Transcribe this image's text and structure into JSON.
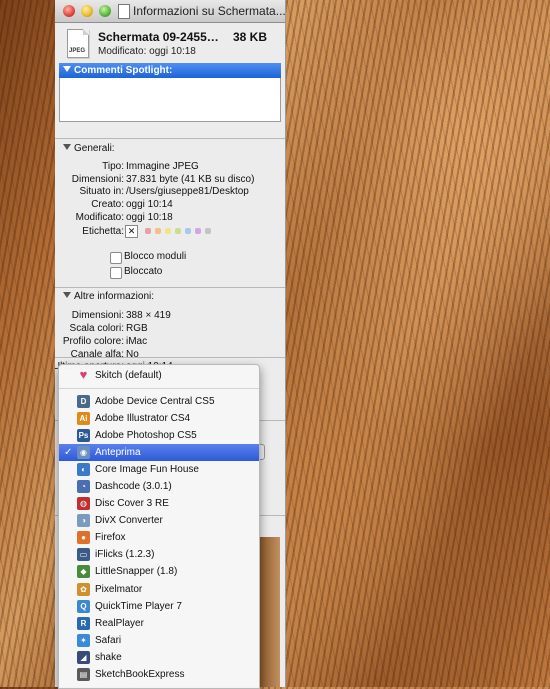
{
  "window": {
    "title": "Informazioni su Schermata..."
  },
  "header": {
    "icon_label": "JPEG",
    "file_name": "Schermata 09-2455…",
    "file_size": "38 KB",
    "modified": "Modificato:  oggi 10:18"
  },
  "spotlight": {
    "heading": "Commenti Spotlight:"
  },
  "general": {
    "heading": "Generali:",
    "rows": [
      {
        "key": "Tipo:",
        "value": "Immagine JPEG"
      },
      {
        "key": "Dimensioni:",
        "value": "37.831 byte (41 KB su disco)"
      },
      {
        "key": "Situato in:",
        "value": "/Users/giuseppe81/Desktop"
      },
      {
        "key": "Creato:",
        "value": "oggi 10:14"
      },
      {
        "key": "Modificato:",
        "value": "oggi 10:18"
      }
    ],
    "label_key": "Etichetta:",
    "label_colors": [
      "#e8a0a0",
      "#f3c08a",
      "#f2e28a",
      "#c9e08a",
      "#a7c9ef",
      "#d3a6df",
      "#c4c4c4"
    ],
    "checkbox_blocco_moduli": "Blocco moduli",
    "checkbox_bloccato": "Bloccato"
  },
  "more_info": {
    "heading": "Altre informazioni:",
    "rows": [
      {
        "key": "Dimensioni:",
        "value": "388 × 419"
      },
      {
        "key": "Scala colori:",
        "value": "RGB"
      },
      {
        "key": "Profilo colore:",
        "value": "iMac"
      },
      {
        "key": "Canale alfa:",
        "value": "No"
      },
      {
        "key": "Ultima apertura:",
        "value": "oggi 10:14"
      }
    ]
  },
  "open_with_menu": {
    "default_item": {
      "label": "Skitch (default)",
      "icon": "skitch-heart-icon",
      "color": "#d8407a"
    },
    "items": [
      {
        "label": "Adobe Device Central CS5",
        "icon": "adobe-device-central-icon",
        "color": "#4a6a8a",
        "glyph": "D"
      },
      {
        "label": "Adobe Illustrator CS4",
        "icon": "adobe-illustrator-icon",
        "color": "#e08a1a",
        "glyph": "Ai"
      },
      {
        "label": "Adobe Photoshop CS5",
        "icon": "adobe-photoshop-icon",
        "color": "#2a5a9a",
        "glyph": "Ps"
      },
      {
        "label": "Anteprima",
        "icon": "preview-icon",
        "color": "#6a8fc0",
        "glyph": "◉",
        "selected": true,
        "check": "✓"
      },
      {
        "label": "Core Image Fun House",
        "icon": "core-image-fun-house-icon",
        "color": "#3a7ac8",
        "glyph": "◐"
      },
      {
        "label": "Dashcode (3.0.1)",
        "icon": "dashcode-icon",
        "color": "#4a6fb0",
        "glyph": "◔"
      },
      {
        "label": "Disc Cover 3 RE",
        "icon": "disc-cover-icon",
        "color": "#c03030",
        "glyph": "◍"
      },
      {
        "label": "DivX Converter",
        "icon": "divx-converter-icon",
        "color": "#7a9ac0",
        "glyph": "◑"
      },
      {
        "label": "Firefox",
        "icon": "firefox-icon",
        "color": "#e0702a",
        "glyph": "●"
      },
      {
        "label": "iFlicks (1.2.3)",
        "icon": "iflicks-icon",
        "color": "#3a5a8a",
        "glyph": "▭"
      },
      {
        "label": "LittleSnapper (1.8)",
        "icon": "littlesnapper-icon",
        "color": "#4a8a3a",
        "glyph": "◆"
      },
      {
        "label": "Pixelmator",
        "icon": "pixelmator-icon",
        "color": "#d09030",
        "glyph": "✿"
      },
      {
        "label": "QuickTime Player 7",
        "icon": "quicktime-icon",
        "color": "#3a8ad0",
        "glyph": "Q"
      },
      {
        "label": "RealPlayer",
        "icon": "realplayer-icon",
        "color": "#2a6ab0",
        "glyph": "R"
      },
      {
        "label": "Safari",
        "icon": "safari-icon",
        "color": "#3a8ad8",
        "glyph": "✦"
      },
      {
        "label": "shake",
        "icon": "shake-icon",
        "color": "#3a4a7a",
        "glyph": "◢"
      },
      {
        "label": "SketchBookExpress",
        "icon": "sketchbook-express-icon",
        "color": "#5a5a5a",
        "glyph": "▤"
      }
    ]
  }
}
